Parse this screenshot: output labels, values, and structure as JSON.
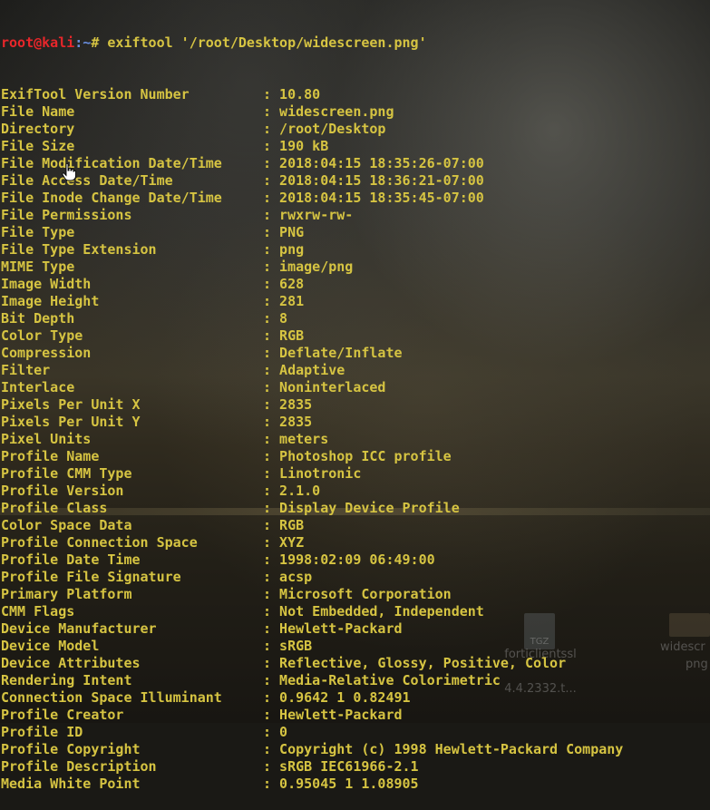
{
  "prompt": {
    "user_host": "root@kali",
    "path": ":~",
    "symbol": "# ",
    "command": "exiftool '/root/Desktop/widescreen.png'"
  },
  "rows": [
    {
      "key": "ExifTool Version Number",
      "value": "10.80"
    },
    {
      "key": "File Name",
      "value": "widescreen.png"
    },
    {
      "key": "Directory",
      "value": "/root/Desktop"
    },
    {
      "key": "File Size",
      "value": "190 kB"
    },
    {
      "key": "File Modification Date/Time",
      "value": "2018:04:15 18:35:26-07:00"
    },
    {
      "key": "File Access Date/Time",
      "value": "2018:04:15 18:36:21-07:00"
    },
    {
      "key": "File Inode Change Date/Time",
      "value": "2018:04:15 18:35:45-07:00"
    },
    {
      "key": "File Permissions",
      "value": "rwxrw-rw-"
    },
    {
      "key": "File Type",
      "value": "PNG"
    },
    {
      "key": "File Type Extension",
      "value": "png"
    },
    {
      "key": "MIME Type",
      "value": "image/png"
    },
    {
      "key": "Image Width",
      "value": "628"
    },
    {
      "key": "Image Height",
      "value": "281"
    },
    {
      "key": "Bit Depth",
      "value": "8"
    },
    {
      "key": "Color Type",
      "value": "RGB"
    },
    {
      "key": "Compression",
      "value": "Deflate/Inflate"
    },
    {
      "key": "Filter",
      "value": "Adaptive"
    },
    {
      "key": "Interlace",
      "value": "Noninterlaced"
    },
    {
      "key": "Pixels Per Unit X",
      "value": "2835"
    },
    {
      "key": "Pixels Per Unit Y",
      "value": "2835"
    },
    {
      "key": "Pixel Units",
      "value": "meters"
    },
    {
      "key": "Profile Name",
      "value": "Photoshop ICC profile"
    },
    {
      "key": "Profile CMM Type",
      "value": "Linotronic"
    },
    {
      "key": "Profile Version",
      "value": "2.1.0"
    },
    {
      "key": "Profile Class",
      "value": "Display Device Profile"
    },
    {
      "key": "Color Space Data",
      "value": "RGB"
    },
    {
      "key": "Profile Connection Space",
      "value": "XYZ"
    },
    {
      "key": "Profile Date Time",
      "value": "1998:02:09 06:49:00"
    },
    {
      "key": "Profile File Signature",
      "value": "acsp"
    },
    {
      "key": "Primary Platform",
      "value": "Microsoft Corporation"
    },
    {
      "key": "CMM Flags",
      "value": "Not Embedded, Independent"
    },
    {
      "key": "Device Manufacturer",
      "value": "Hewlett-Packard"
    },
    {
      "key": "Device Model",
      "value": "sRGB"
    },
    {
      "key": "Device Attributes",
      "value": "Reflective, Glossy, Positive, Color"
    },
    {
      "key": "Rendering Intent",
      "value": "Media-Relative Colorimetric"
    },
    {
      "key": "Connection Space Illuminant",
      "value": "0.9642 1 0.82491"
    },
    {
      "key": "Profile Creator",
      "value": "Hewlett-Packard"
    },
    {
      "key": "Profile ID",
      "value": "0"
    },
    {
      "key": "Profile Copyright",
      "value": "Copyright (c) 1998 Hewlett-Packard Company"
    },
    {
      "key": "Profile Description",
      "value": "sRGB IEC61966-2.1"
    },
    {
      "key": "Media White Point",
      "value": "0.95045 1 1.08905"
    }
  ],
  "separator": ": ",
  "desktop": {
    "icon1_badge": "TGZ",
    "icon1_label": "forticlientssl",
    "icon1_sub": "4.4.2332.t...",
    "icon2_label_a": "widescr",
    "icon2_label_b": "png"
  },
  "colors": {
    "text": "#d6c442",
    "prompt_user": "#e8262a",
    "prompt_path": "#6a8fe0"
  },
  "cursor_icon": "hand-pointer-icon"
}
